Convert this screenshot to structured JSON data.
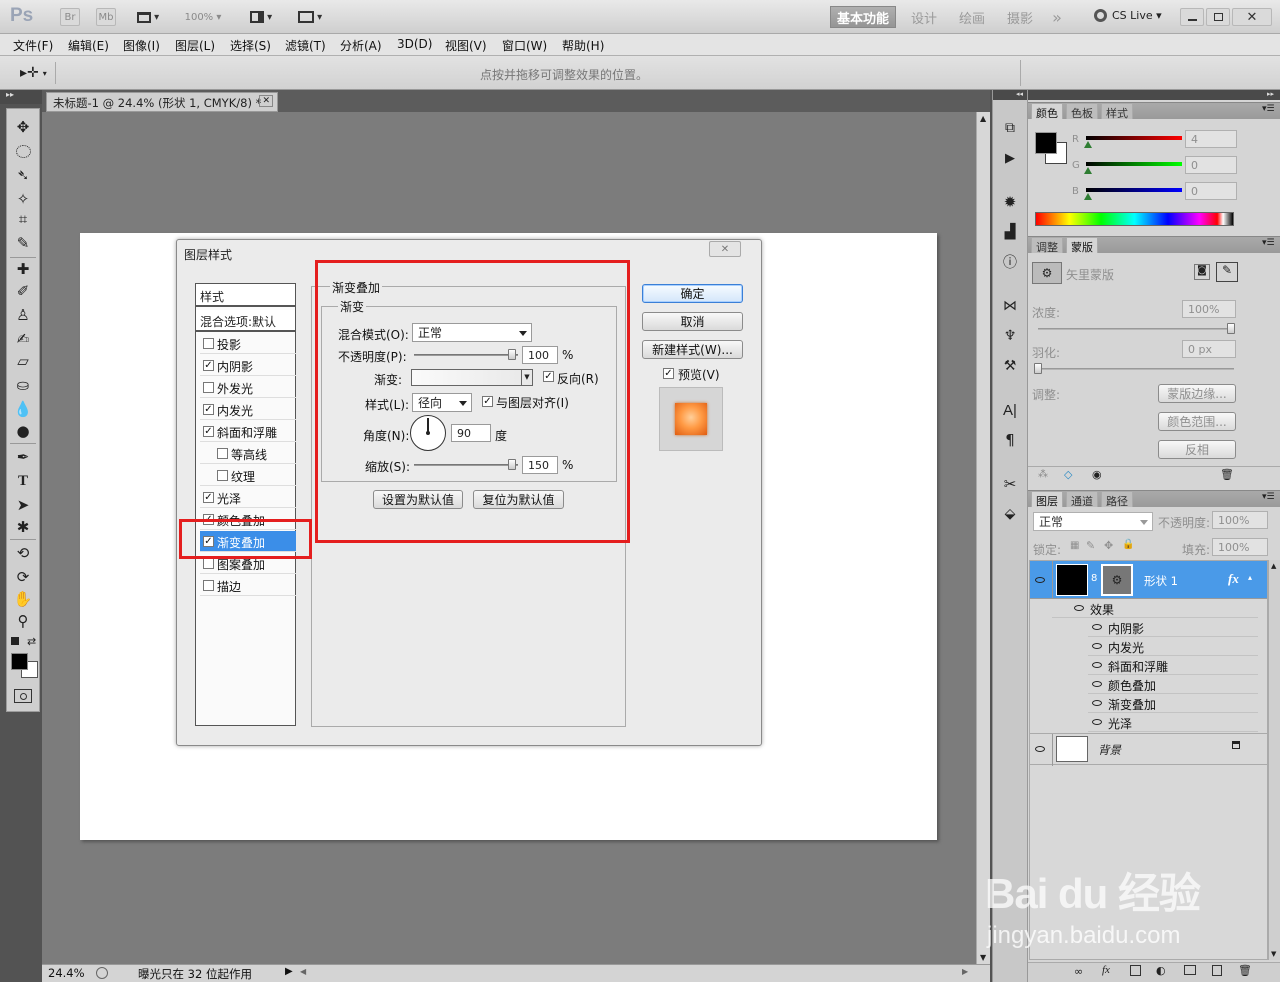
{
  "titlebar": {
    "ps_logo": "Ps",
    "br_label": "Br",
    "mb_label": "Mb",
    "zoom": "100%",
    "workspaces": [
      "基本功能",
      "设计",
      "绘画",
      "摄影"
    ],
    "more": "»",
    "cslive": "CS Live"
  },
  "menu": [
    "文件(F)",
    "编辑(E)",
    "图像(I)",
    "图层(L)",
    "选择(S)",
    "滤镜(T)",
    "分析(A)",
    "3D(D)",
    "视图(V)",
    "窗口(W)",
    "帮助(H)"
  ],
  "options_bar": {
    "hint": "点按并拖移可调整效果的位置。"
  },
  "document": {
    "tab_title": "未标题-1 @ 24.4% (形状 1, CMYK/8) *",
    "close": "✕"
  },
  "status": {
    "zoom": "24.4%",
    "message": "曝光只在 32 位起作用"
  },
  "dialog": {
    "title": "图层样式",
    "styles_header": "样式",
    "blend_options": "混合选项:默认",
    "style_items": [
      {
        "label": "投影",
        "checked": false
      },
      {
        "label": "内阴影",
        "checked": true
      },
      {
        "label": "外发光",
        "checked": false
      },
      {
        "label": "内发光",
        "checked": true
      },
      {
        "label": "斜面和浮雕",
        "checked": true
      },
      {
        "label": "等高线",
        "checked": false
      },
      {
        "label": "纹理",
        "checked": false
      },
      {
        "label": "光泽",
        "checked": true
      },
      {
        "label": "颜色叠加",
        "checked": true
      },
      {
        "label": "渐变叠加",
        "checked": true
      },
      {
        "label": "图案叠加",
        "checked": false
      },
      {
        "label": "描边",
        "checked": false
      }
    ],
    "section_title": "渐变叠加",
    "group_title": "渐变",
    "blend_mode_label": "混合模式(O):",
    "blend_mode_value": "正常",
    "opacity_label": "不透明度(P):",
    "opacity_value": "100",
    "percent": "%",
    "gradient_label": "渐变:",
    "reverse_label": "反向(R)",
    "style_label": "样式(L):",
    "style_value": "径向",
    "align_label": "与图层对齐(I)",
    "angle_label": "角度(N):",
    "angle_value": "90",
    "degree": "度",
    "scale_label": "缩放(S):",
    "scale_value": "150",
    "make_default": "设置为默认值",
    "reset_default": "复位为默认值",
    "ok": "确定",
    "cancel": "取消",
    "new_style": "新建样式(W)...",
    "preview_label": "预览(V)",
    "close_icon": "✕"
  },
  "color_panel": {
    "tabs": [
      "颜色",
      "色板",
      "样式"
    ],
    "r_label": "R",
    "g_label": "G",
    "b_label": "B",
    "r_value": "4",
    "g_value": "0",
    "b_value": "0"
  },
  "masks_panel": {
    "tabs": [
      "调整",
      "蒙版"
    ],
    "vector_mask": "矢里蒙版",
    "density_label": "浓度:",
    "density_value": "100%",
    "feather_label": "羽化:",
    "feather_value": "0 px",
    "refine_label": "调整:",
    "mask_edge": "蒙版边缘...",
    "color_range": "颜色范围...",
    "invert": "反相"
  },
  "layers_panel": {
    "tabs": [
      "图层",
      "通道",
      "路径"
    ],
    "blend_mode": "正常",
    "opacity_label": "不透明度:",
    "opacity_value": "100%",
    "lock_label": "锁定:",
    "fill_label": "填充:",
    "fill_value": "100%",
    "layer_name": "形状 1",
    "fx": "fx",
    "effects_label": "效果",
    "effects": [
      "内阴影",
      "内发光",
      "斜面和浮雕",
      "颜色叠加",
      "渐变叠加",
      "光泽"
    ],
    "background": "背景"
  },
  "watermark": {
    "brand": "Bai du 经验",
    "url": "jingyan.baidu.com"
  },
  "colors": {
    "highlight_red": "#e41e1e",
    "selection_blue": "#3b8ee8",
    "layer_selected": "#4a9ae8"
  }
}
